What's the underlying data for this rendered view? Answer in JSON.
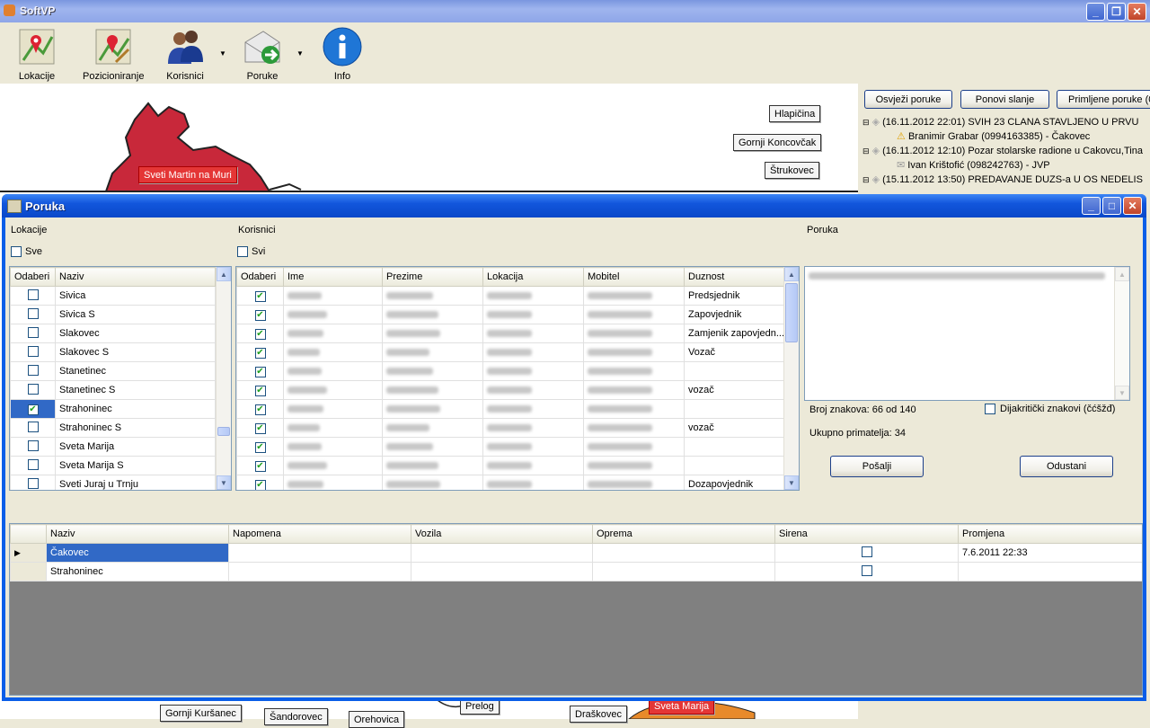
{
  "app": {
    "title": "SoftVP"
  },
  "toolbar": {
    "items": [
      {
        "label": "Lokacije"
      },
      {
        "label": "Pozicioniranje"
      },
      {
        "label": "Korisnici"
      },
      {
        "label": "Poruke"
      },
      {
        "label": "Info"
      }
    ]
  },
  "map": {
    "labels": [
      "Hlapičina",
      "Gornji Koncovčak",
      "Štrukovec",
      "Sveti Martin na Muri",
      "Gornji Kuršanec",
      "Šandorovec",
      "Orehovica",
      "Prelog",
      "Draškovec",
      "Sveta Marija"
    ]
  },
  "rightpanel": {
    "buttons": [
      "Osvježi poruke",
      "Ponovi slanje",
      "Primljene poruke (0)"
    ],
    "tree": [
      "(16.11.2012 22:01) SVIH 23 CLANA STAVLJENO U PRVU",
      "Branimir Grabar (0994163385) - Čakovec",
      "(16.11.2012 12:10) Pozar stolarske radione u Cakovcu,Tina",
      "Ivan Krištofić (098242763) - JVP",
      "(15.11.2012 13:50) PREDAVANJE DUZS-a U OS NEDELIS"
    ]
  },
  "dialog": {
    "title": "Poruka",
    "lokacije_label": "Lokacije",
    "sve_label": "Sve",
    "korisnici_label": "Korisnici",
    "svi_label": "Svi",
    "poruka_label": "Poruka",
    "loc_headers": [
      "Odaberi",
      "Naziv"
    ],
    "locations": [
      {
        "name": "Sivica",
        "checked": false
      },
      {
        "name": "Sivica S",
        "checked": false
      },
      {
        "name": "Slakovec",
        "checked": false
      },
      {
        "name": "Slakovec S",
        "checked": false
      },
      {
        "name": "Stanetinec",
        "checked": false
      },
      {
        "name": "Stanetinec S",
        "checked": false
      },
      {
        "name": "Strahoninec",
        "checked": true
      },
      {
        "name": "Strahoninec S",
        "checked": false
      },
      {
        "name": "Sveta Marija",
        "checked": false
      },
      {
        "name": "Sveta Marija S",
        "checked": false
      },
      {
        "name": "Sveti Juraj u Trnju",
        "checked": false
      }
    ],
    "user_headers": [
      "Odaberi",
      "Ime",
      "Prezime",
      "Lokacija",
      "Mobitel",
      "Duznost"
    ],
    "users": [
      {
        "duty": "Predsjednik"
      },
      {
        "duty": "Zapovjednik"
      },
      {
        "duty": "Zamjenik zapovjedn..."
      },
      {
        "duty": "Vozač"
      },
      {
        "duty": ""
      },
      {
        "duty": "vozač"
      },
      {
        "duty": ""
      },
      {
        "duty": "vozač"
      },
      {
        "duty": ""
      },
      {
        "duty": ""
      },
      {
        "duty": "Dozapovjednik"
      }
    ],
    "char_count": "Broj znakova: 66 od 140",
    "diacritics_label": "Dijakritički znakovi (čćšžđ)",
    "total_recipients": "Ukupno primatelja: 34",
    "send_button": "Pošalji",
    "cancel_button": "Odustani",
    "bottom_headers": [
      "Naziv",
      "Napomena",
      "Vozila",
      "Oprema",
      "Sirena",
      "Promjena"
    ],
    "bottom_rows": [
      {
        "name": "Čakovec",
        "changed": "7.6.2011 22:33"
      },
      {
        "name": "Strahoninec",
        "changed": ""
      }
    ]
  },
  "colors": {
    "titlebar": "#0a5ee8",
    "selection": "#3169c6",
    "map_red": "#c8283a"
  }
}
